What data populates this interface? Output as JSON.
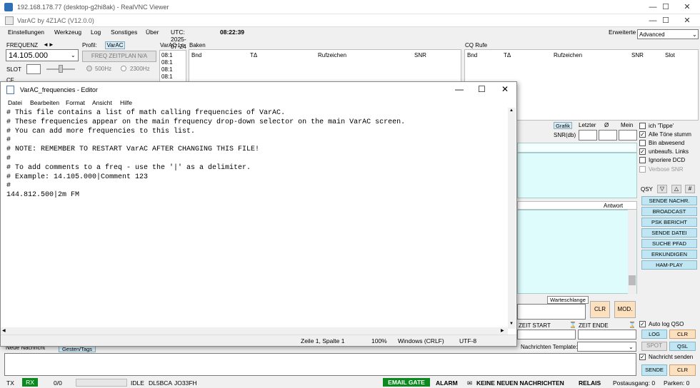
{
  "vnc": {
    "title": "192.168.178.77 (desktop-g2hi8ak) - RealVNC Viewer"
  },
  "app": {
    "title": "VarAC by 4Z1AC (V12.0.0)"
  },
  "menu": {
    "items": [
      "Einstellungen",
      "Werkzeug",
      "Log",
      "Sonstiges",
      "Über"
    ],
    "utc_label": "UTC: 2025-07-24",
    "time": "08:22:39",
    "mode_label": "Erweiterte",
    "mode_value": "Advanced"
  },
  "left": {
    "freq_label": "FREQUENZ",
    "freq_arrows": "◄►",
    "freq_value": "14.105.000",
    "slot_label": "SLOT",
    "cf_label": "CF",
    "profile_label": "Profil:",
    "profile_value": "VarAC",
    "freq_plan_btn": "FREQ ZEITPLAN N/A",
    "bw1": "500Hz",
    "bw2": "2300Hz",
    "varac_log_label": "VarAC Lo",
    "log_times": [
      "08:1",
      "08:1",
      "08:1",
      "08:1"
    ]
  },
  "baken": {
    "title": "Baken",
    "cols": [
      "Bnd",
      "TΔ",
      "Rufzeichen",
      "SNR"
    ]
  },
  "cq": {
    "title": "CQ Rufe",
    "cols": [
      "Bnd",
      "TΔ",
      "Rufzeichen",
      "SNR",
      "Slot"
    ]
  },
  "right": {
    "grafik": "Grafik",
    "letzter": "Letzter",
    "avg": "Ø",
    "mein": "Mein",
    "snr_label": "SNR(db)",
    "antwort": "Antwort",
    "warteschlange": "Warteschlange",
    "clr": "CLR",
    "mod": "MOD.",
    "qsy": "QSY",
    "checks": [
      {
        "label": "ich 'Tippe'",
        "checked": false
      },
      {
        "label": "Alle Töne stumm",
        "checked": true
      },
      {
        "label": "Bin abwesend",
        "checked": false
      },
      {
        "label": "unbeaufs. Links",
        "checked": true
      },
      {
        "label": "Ignoriere DCD",
        "checked": false
      },
      {
        "label": "Verbose SNR",
        "checked": false
      }
    ],
    "buttons": [
      "SENDE NACHR.",
      "BROADCAST",
      "PSK BERICHT",
      "SENDE DATEI",
      "SUCHE PFAD",
      "ERKUNDIGEN",
      "HAM-PLAY"
    ],
    "zeit_start": "ZEIT START",
    "zeit_ende": "ZEIT ENDE",
    "auto_log": "Auto log QSO",
    "log": "LOG",
    "clr2": "CLR",
    "spot": "SPOT",
    "qsl": "QSL",
    "template_label": "Nachrichten Template:",
    "nachricht_senden": "Nachricht senden",
    "sende": "SENDE",
    "clr3": "CLR"
  },
  "bottom": {
    "neue_nachricht": "Neue Nachricht",
    "gesten_tab": "Gesten/Tags"
  },
  "status": {
    "tx": "TX",
    "rx": "RX",
    "count": "0/0",
    "idle": "IDLE",
    "call": "DL5BCA",
    "grid": "JO33FH",
    "email_gate": "EMAIL GATE",
    "alarm": "ALARM",
    "no_msgs": "KEINE NEUEN NACHRICHTEN",
    "relais": "RELAIS",
    "postausgang": "Postausgang: 0",
    "parken": "Parken: 0"
  },
  "editor": {
    "title": "VarAC_frequencies - Editor",
    "menu": [
      "Datei",
      "Bearbeiten",
      "Format",
      "Ansicht",
      "Hilfe"
    ],
    "lines": [
      "# This file contains a list of math calling frequencies of VarAC.",
      "# These frequencies appear on the main frequency drop-down selector on the main VarAC screen.",
      "# You can add more frequencies to this list.",
      "#",
      "# NOTE: REMEMBER TO RESTART VarAC AFTER CHANGING THIS FILE!",
      "#",
      "# To add comments to a freq - use the '|' as a delimiter.",
      "# Example: 14.105.000|Comment 123",
      "#",
      "144.812.500|2m FM"
    ],
    "status": {
      "position": "Zeile 1, Spalte 1",
      "zoom": "100%",
      "eol": "Windows (CRLF)",
      "encoding": "UTF-8"
    }
  }
}
